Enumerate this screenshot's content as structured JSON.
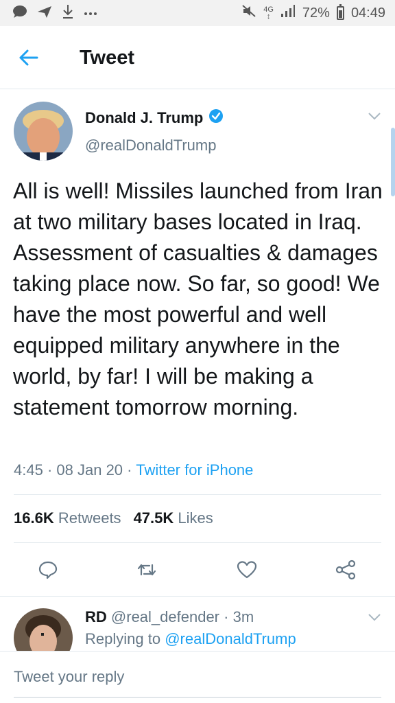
{
  "status_bar": {
    "notification_icons": [
      "message-icon",
      "send-icon",
      "download-icon",
      "more-dots-icon"
    ],
    "network": "4G",
    "battery": "72%",
    "time": "04:49"
  },
  "header": {
    "title": "Tweet"
  },
  "tweet": {
    "display_name": "Donald J. Trump",
    "handle": "@realDonaldTrump",
    "verified": true,
    "text": "All is well! Missiles launched from Iran at two military bases located in Iraq. Assessment of casualties & damages taking place now. So far, so good! We have the most powerful and well equipped military anywhere in the world, by far! I will be making a statement tomorrow morning.",
    "time": "4:45",
    "date": "08 Jan 20",
    "source": "Twitter for iPhone",
    "sep": "·",
    "retweets_count": "16.6K",
    "retweets_label": "Retweets",
    "likes_count": "47.5K",
    "likes_label": "Likes"
  },
  "reply": {
    "name": "RD",
    "handle": "@real_defender",
    "time": "· 3m",
    "replying_to_label": "Replying to",
    "replying_to_handle": "@realDonaldTrump"
  },
  "compose": {
    "placeholder": "Tweet your reply"
  },
  "colors": {
    "accent": "#1da1f2",
    "secondary_text": "#657786",
    "divider": "#e1e8ed"
  }
}
